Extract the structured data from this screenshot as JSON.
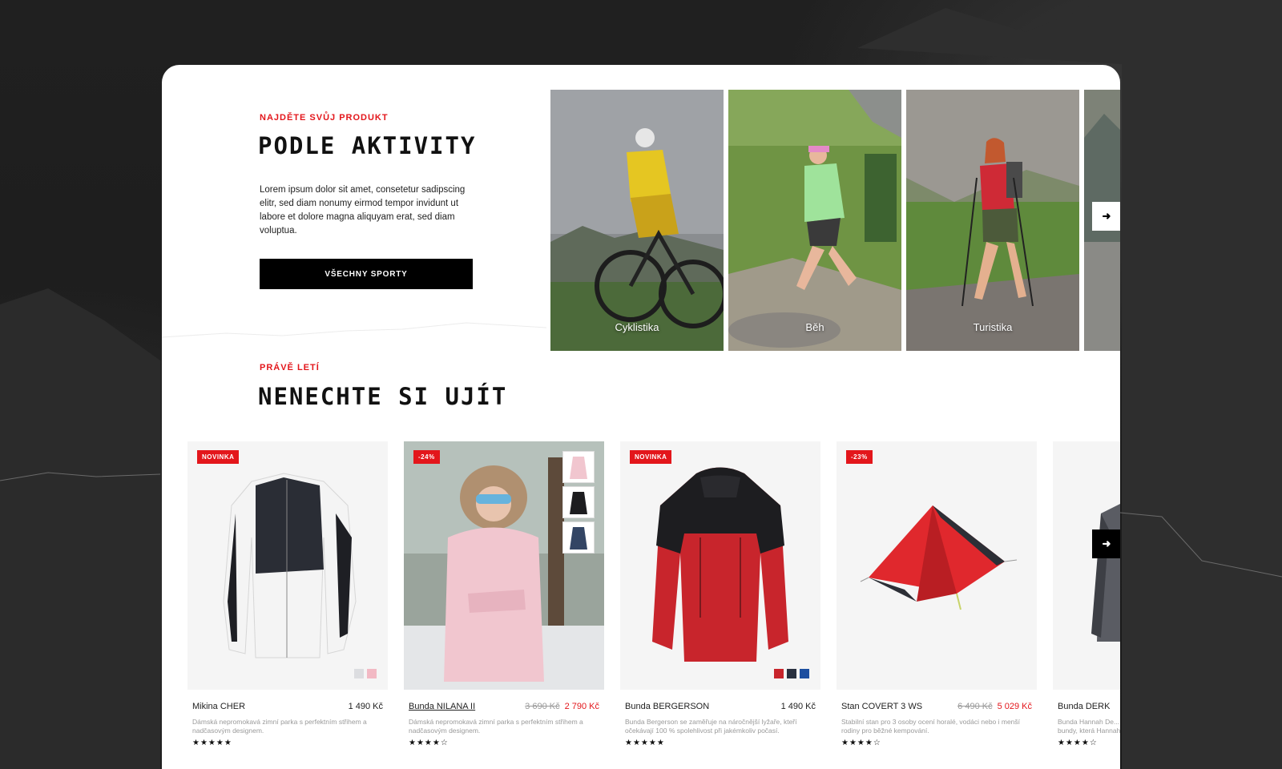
{
  "activity": {
    "eyebrow": "NAJDĚTE SVŮJ PRODUKT",
    "title": "PODLE AKTIVITY",
    "intro": "Lorem ipsum dolor sit amet, consetetur sadipscing elitr, sed diam nonumy eirmod tempor invidunt ut labore et dolore magna aliquyam erat, sed diam voluptua.",
    "button": "VŠECHNY SPORTY",
    "tiles": [
      {
        "label": "Cyklistika"
      },
      {
        "label": "Běh"
      },
      {
        "label": "Turistika"
      }
    ],
    "next_icon": "arrow-right-icon"
  },
  "products": {
    "eyebrow": "PRÁVĚ LETÍ",
    "title": "NENECHTE SI UJÍT",
    "next_icon": "arrow-right-icon",
    "items": [
      {
        "badge": "NOVINKA",
        "name": "Mikina CHER",
        "price": "1 490 Kč",
        "desc": "Dámská nepromokavá zimní parka s perfektním střihem a nadčasovým designem.",
        "stars": "★★★★★",
        "swatches": [
          "#dcdde0",
          "#f2b9c4"
        ]
      },
      {
        "badge": "-24%",
        "name": "Bunda NILANA II",
        "price_old": "3 690 Kč",
        "price": "2 790 Kč",
        "desc": "Dámská nepromokavá zimní parka s perfektním střihem a nadčasovým designem.",
        "stars": "★★★★☆"
      },
      {
        "badge": "NOVINKA",
        "name": "Bunda BERGERSON",
        "price": "1 490 Kč",
        "desc": "Bunda Bergerson se zaměřuje na náročnější lyžaře, kteří očekávají 100 % spolehlivost při jakémkoliv počasí.",
        "stars": "★★★★★",
        "swatches": [
          "#c8252c",
          "#2a3140",
          "#1d4fa0"
        ]
      },
      {
        "badge": "-23%",
        "name": "Stan COVERT 3 WS",
        "price_old": "6 490 Kč",
        "price": "5 029 Kč",
        "desc": "Stabilní stan pro 3 osoby ocení horalé, vodáci nebo i menší rodiny pro běžné kempování.",
        "stars": "★★★★☆"
      },
      {
        "name": "Bunda DERK",
        "desc": "Bunda Hannah De... bundy, která Hannah",
        "stars": "★★★★☆"
      }
    ]
  },
  "colors": {
    "accent": "#e3161b",
    "dark": "#000000"
  }
}
